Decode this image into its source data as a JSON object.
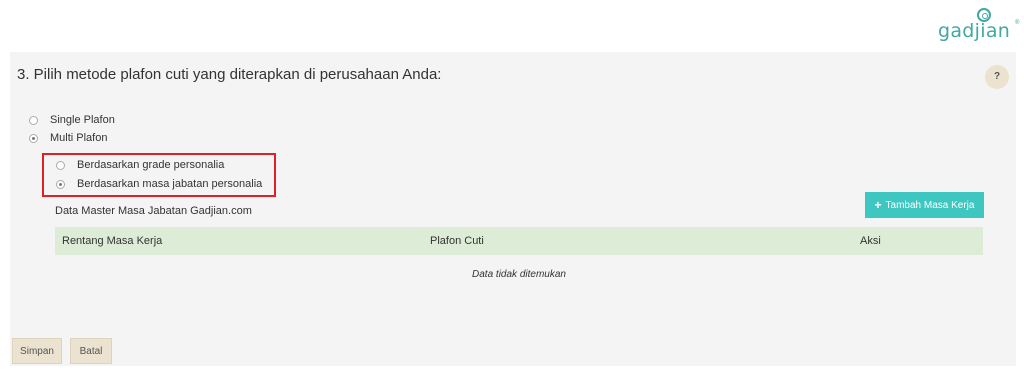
{
  "brand": {
    "logo_text": "gadjian",
    "color": "#41a7a2"
  },
  "question": {
    "title": "3. Pilih metode plafon cuti yang diterapkan di perusahaan Anda:",
    "help_label": "?"
  },
  "plafon_options": [
    {
      "label": "Single Plafon",
      "checked": false
    },
    {
      "label": "Multi Plafon",
      "checked": true
    }
  ],
  "multi_options": [
    {
      "label": "Berdasarkan grade personalia",
      "checked": false
    },
    {
      "label": "Berdasarkan masa jabatan personalia",
      "checked": true
    }
  ],
  "master": {
    "label": "Data Master Masa Jabatan Gadjian.com",
    "add_button": "Tambah Masa Kerja"
  },
  "table": {
    "columns": [
      "Rentang Masa Kerja",
      "Plafon Cuti",
      "Aksi"
    ],
    "empty_message": "Data tidak ditemukan"
  },
  "actions": {
    "save": "Simpan",
    "cancel": "Batal"
  },
  "colors": {
    "accent": "#3ec7c0",
    "highlight": "#e01f26",
    "table_header": "#dcecd6",
    "button_bg": "#ebe3cf"
  }
}
